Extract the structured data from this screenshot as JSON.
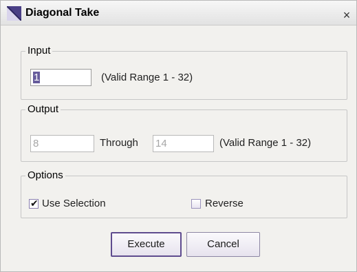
{
  "window": {
    "title": "Diagonal Take",
    "close_glyph": "×",
    "icon": "diagonal-take-app-icon",
    "accent_color": "#5e4b8e"
  },
  "input_group": {
    "legend": "Input",
    "value": "1",
    "range_label": "(Valid Range 1 - 32)"
  },
  "output_group": {
    "legend": "Output",
    "from_value": "8",
    "through_label": "Through",
    "to_value": "14",
    "range_label": "(Valid Range 1 - 32)"
  },
  "options_group": {
    "legend": "Options",
    "use_selection": {
      "label": "Use Selection",
      "checked": true
    },
    "reverse": {
      "label": "Reverse",
      "checked": false
    }
  },
  "buttons": {
    "execute_label": "Execute",
    "cancel_label": "Cancel"
  }
}
